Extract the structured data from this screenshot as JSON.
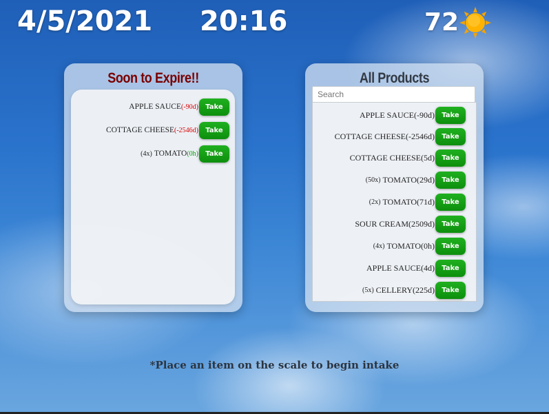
{
  "header": {
    "date": "4/5/2021",
    "time": "20:16",
    "temperature": "72",
    "weather_icon": "sun-icon"
  },
  "expire_panel": {
    "title": "Soon to Expire!!",
    "items": [
      {
        "qty": "",
        "name": "APPLE SAUCE",
        "days": "(-90d)",
        "days_color": "red",
        "button": "Take"
      },
      {
        "qty": "",
        "name": "COTTAGE CHEESE",
        "days": "(-2546d)",
        "days_color": "red",
        "button": "Take"
      },
      {
        "qty": "(4x)",
        "name": "TOMATO",
        "days": "(0h)",
        "days_color": "green",
        "button": "Take"
      }
    ]
  },
  "all_panel": {
    "title": "All Products",
    "search_placeholder": "Search",
    "items": [
      {
        "qty": "",
        "name": "APPLE SAUCE(-90d)",
        "button": "Take"
      },
      {
        "qty": "",
        "name": "COTTAGE CHEESE(-2546d)",
        "button": "Take"
      },
      {
        "qty": "",
        "name": "COTTAGE CHEESE(5d)",
        "button": "Take"
      },
      {
        "qty": "(50x)",
        "name": "TOMATO(29d)",
        "button": "Take"
      },
      {
        "qty": "(2x)",
        "name": "TOMATO(71d)",
        "button": "Take"
      },
      {
        "qty": "",
        "name": "SOUR CREAM(2509d)",
        "button": "Take"
      },
      {
        "qty": "(4x)",
        "name": "TOMATO(0h)",
        "button": "Take"
      },
      {
        "qty": "",
        "name": "APPLE SAUCE(4d)",
        "button": "Take"
      },
      {
        "qty": "(5x)",
        "name": "CELLERY(225d)",
        "button": "Take"
      }
    ]
  },
  "footer": {
    "instruction": "*Place an item on the scale to begin intake"
  },
  "colors": {
    "take_button": "#14a014",
    "expire_title": "#7a0000",
    "expired_days": "#d80000",
    "fresh_days": "#0a9a0a"
  }
}
